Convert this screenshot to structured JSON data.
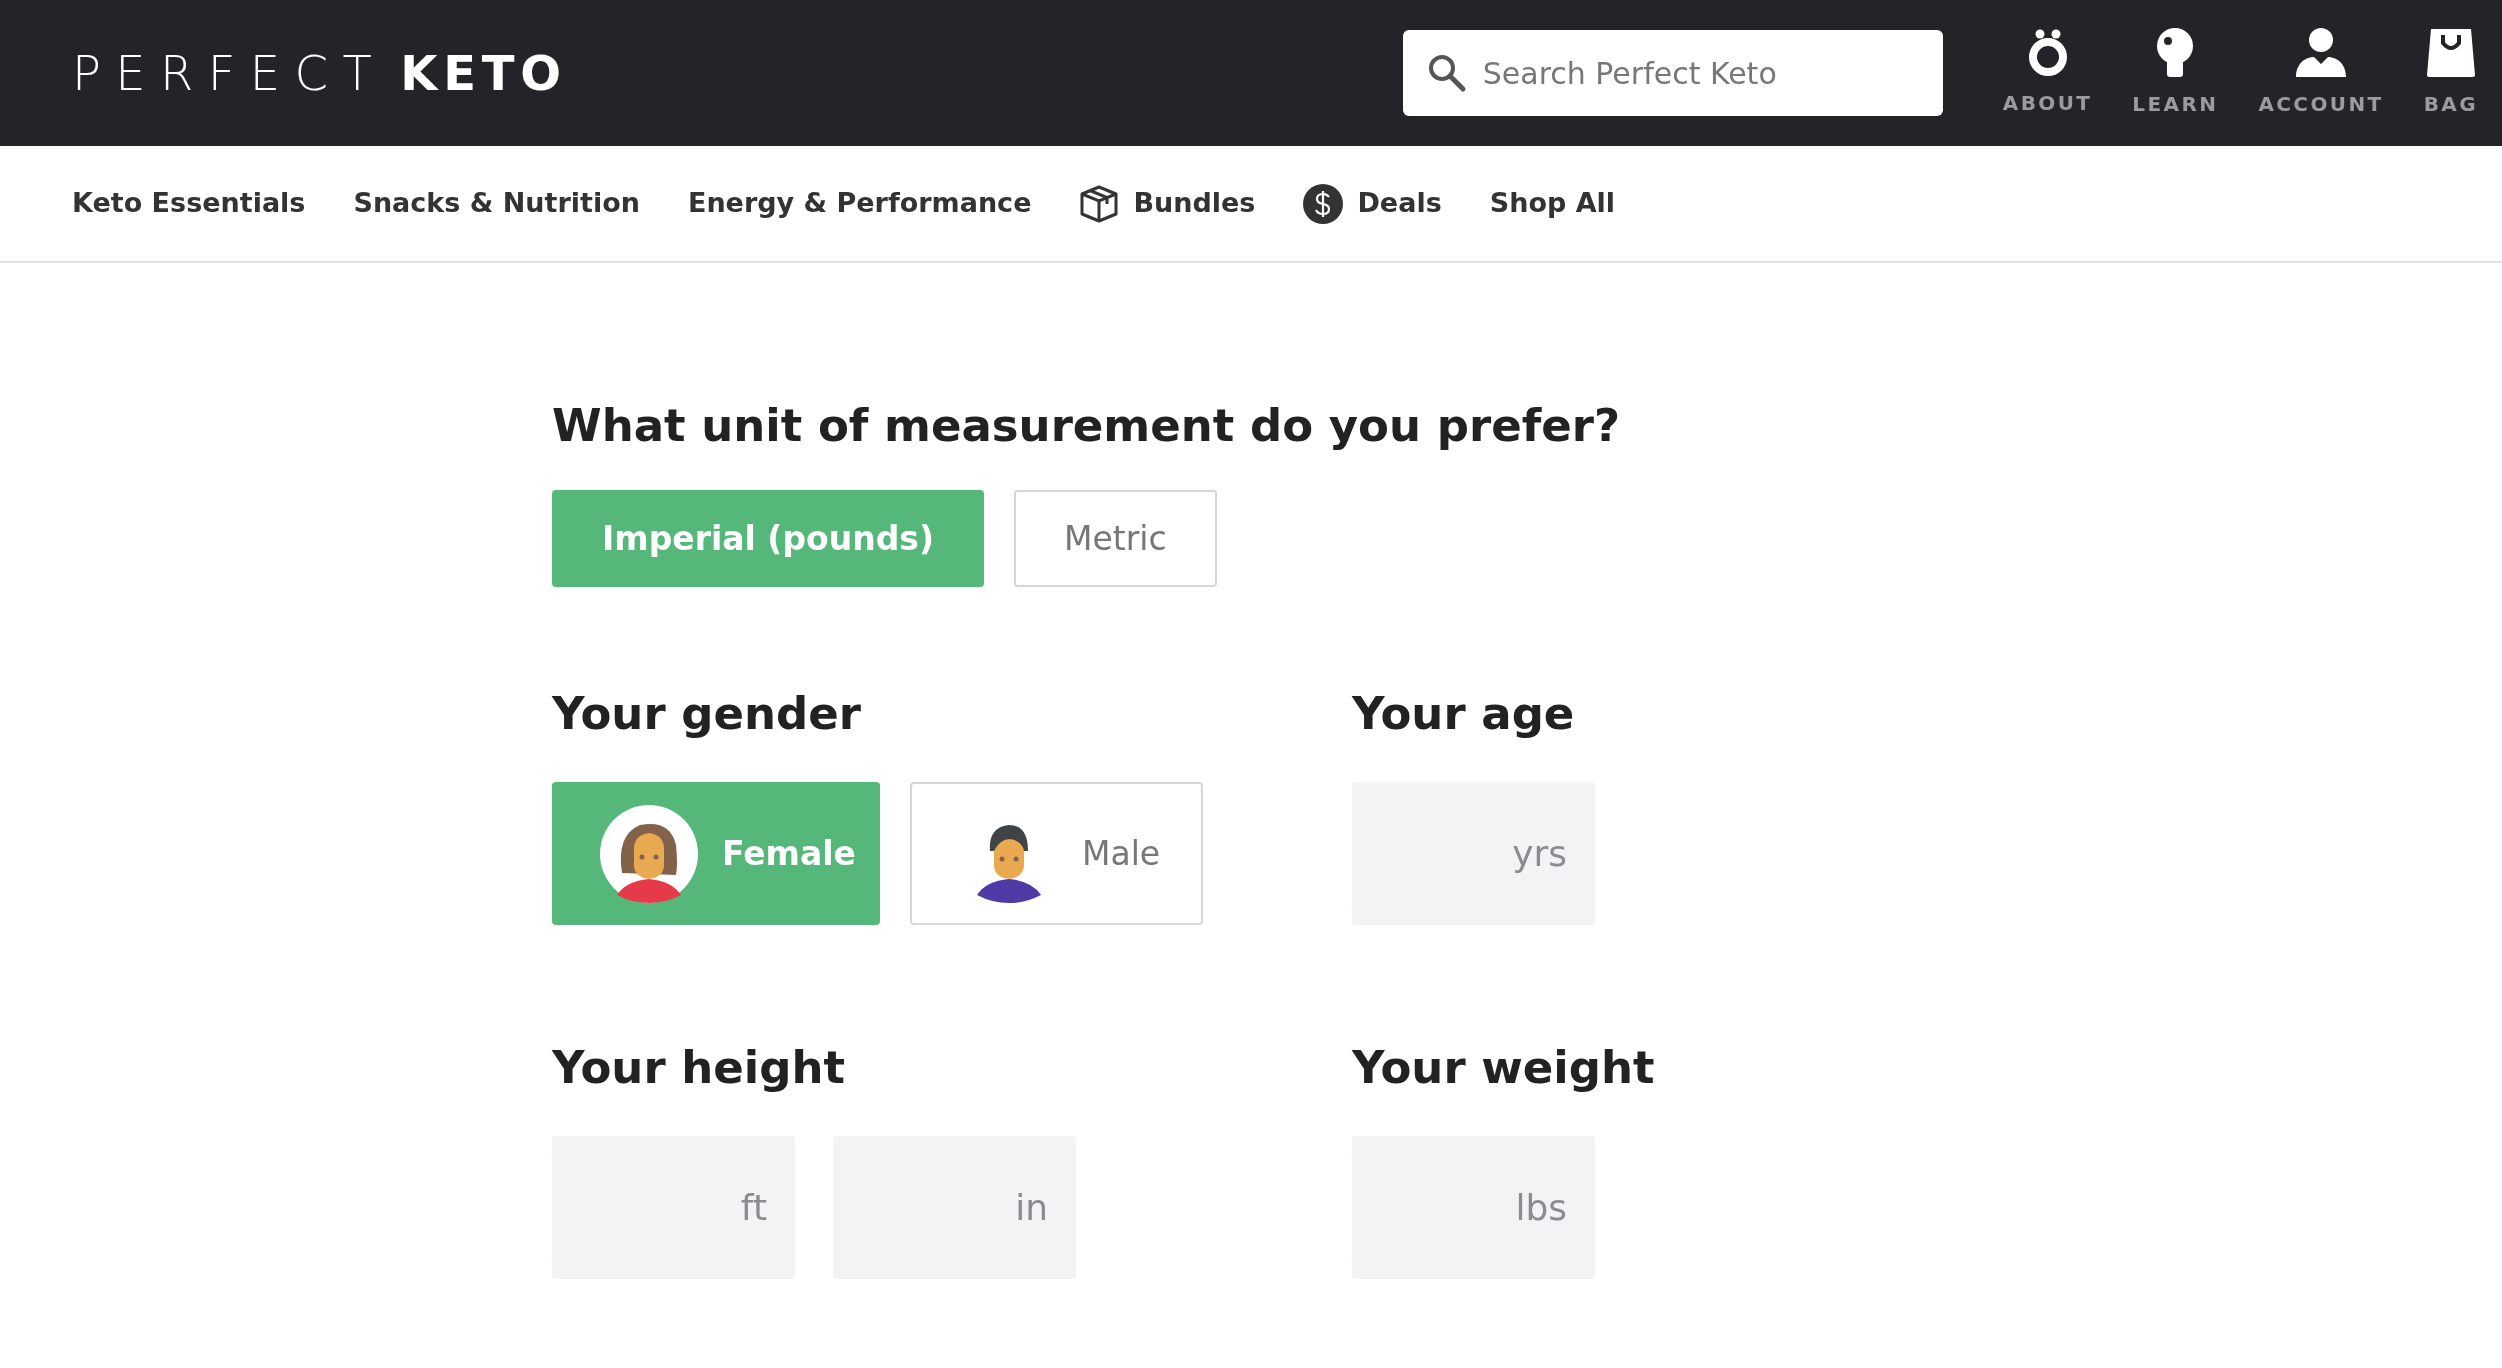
{
  "header": {
    "logo_light": "PERFECT",
    "logo_bold": "KETO",
    "search": {
      "placeholder": "Search Perfect Keto"
    },
    "links": [
      {
        "kind": "about",
        "label": "ABOUT"
      },
      {
        "kind": "learn",
        "label": "LEARN"
      },
      {
        "kind": "account",
        "label": "ACCOUNT"
      },
      {
        "kind": "bag",
        "label": "BAG"
      }
    ]
  },
  "nav": [
    {
      "label": "Keto Essentials"
    },
    {
      "label": "Snacks & Nutrition"
    },
    {
      "label": "Energy & Performance"
    },
    {
      "label": "Bundles",
      "kind": "box"
    },
    {
      "label": "Deals",
      "kind": "dollar"
    },
    {
      "label": "Shop All"
    }
  ],
  "unit": {
    "question": "What unit of measurement do you prefer?",
    "options": [
      {
        "label": "Imperial (pounds)",
        "selected": true
      },
      {
        "label": "Metric",
        "selected": false
      }
    ]
  },
  "gender": {
    "heading": "Your gender",
    "options": [
      {
        "label": "Female",
        "kind": "female",
        "selected": true
      },
      {
        "label": "Male",
        "kind": "male",
        "selected": false
      }
    ]
  },
  "age": {
    "heading": "Your age",
    "fields": [
      {
        "unit": "yrs"
      }
    ]
  },
  "height": {
    "heading": "Your height",
    "fields": [
      {
        "unit": "ft"
      },
      {
        "unit": "in"
      }
    ]
  },
  "weight": {
    "heading": "Your weight",
    "fields": [
      {
        "unit": "lbs"
      }
    ]
  }
}
